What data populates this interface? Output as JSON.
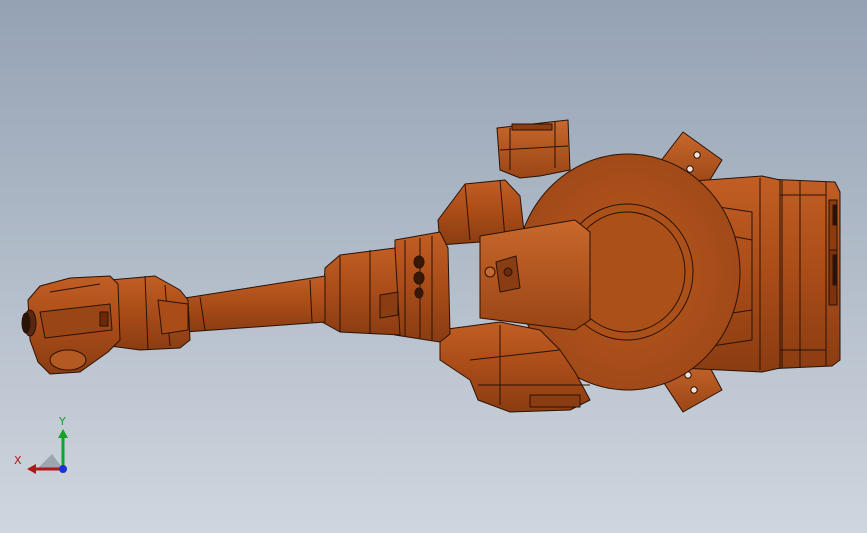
{
  "viewport": {
    "background_top": "#95a2b4",
    "background_bottom": "#cfd6de",
    "model": {
      "part_color": "#b5541c",
      "part_color_dark": "#7a3310",
      "edge_color": "#2a1206",
      "icon": "robot-arm-model"
    },
    "triad": {
      "x_label": "X",
      "y_label": "Y",
      "x_color": "#b01818",
      "y_color": "#17a02a",
      "z_color": "#1a2fd6"
    }
  }
}
